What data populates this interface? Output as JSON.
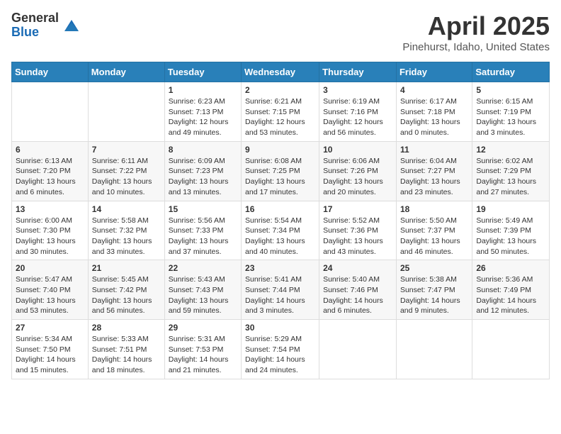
{
  "logo": {
    "general": "General",
    "blue": "Blue"
  },
  "title": "April 2025",
  "subtitle": "Pinehurst, Idaho, United States",
  "days_header": [
    "Sunday",
    "Monday",
    "Tuesday",
    "Wednesday",
    "Thursday",
    "Friday",
    "Saturday"
  ],
  "weeks": [
    [
      {
        "day": "",
        "sunrise": "",
        "sunset": "",
        "daylight": ""
      },
      {
        "day": "",
        "sunrise": "",
        "sunset": "",
        "daylight": ""
      },
      {
        "day": "1",
        "sunrise": "Sunrise: 6:23 AM",
        "sunset": "Sunset: 7:13 PM",
        "daylight": "Daylight: 12 hours and 49 minutes."
      },
      {
        "day": "2",
        "sunrise": "Sunrise: 6:21 AM",
        "sunset": "Sunset: 7:15 PM",
        "daylight": "Daylight: 12 hours and 53 minutes."
      },
      {
        "day": "3",
        "sunrise": "Sunrise: 6:19 AM",
        "sunset": "Sunset: 7:16 PM",
        "daylight": "Daylight: 12 hours and 56 minutes."
      },
      {
        "day": "4",
        "sunrise": "Sunrise: 6:17 AM",
        "sunset": "Sunset: 7:18 PM",
        "daylight": "Daylight: 13 hours and 0 minutes."
      },
      {
        "day": "5",
        "sunrise": "Sunrise: 6:15 AM",
        "sunset": "Sunset: 7:19 PM",
        "daylight": "Daylight: 13 hours and 3 minutes."
      }
    ],
    [
      {
        "day": "6",
        "sunrise": "Sunrise: 6:13 AM",
        "sunset": "Sunset: 7:20 PM",
        "daylight": "Daylight: 13 hours and 6 minutes."
      },
      {
        "day": "7",
        "sunrise": "Sunrise: 6:11 AM",
        "sunset": "Sunset: 7:22 PM",
        "daylight": "Daylight: 13 hours and 10 minutes."
      },
      {
        "day": "8",
        "sunrise": "Sunrise: 6:09 AM",
        "sunset": "Sunset: 7:23 PM",
        "daylight": "Daylight: 13 hours and 13 minutes."
      },
      {
        "day": "9",
        "sunrise": "Sunrise: 6:08 AM",
        "sunset": "Sunset: 7:25 PM",
        "daylight": "Daylight: 13 hours and 17 minutes."
      },
      {
        "day": "10",
        "sunrise": "Sunrise: 6:06 AM",
        "sunset": "Sunset: 7:26 PM",
        "daylight": "Daylight: 13 hours and 20 minutes."
      },
      {
        "day": "11",
        "sunrise": "Sunrise: 6:04 AM",
        "sunset": "Sunset: 7:27 PM",
        "daylight": "Daylight: 13 hours and 23 minutes."
      },
      {
        "day": "12",
        "sunrise": "Sunrise: 6:02 AM",
        "sunset": "Sunset: 7:29 PM",
        "daylight": "Daylight: 13 hours and 27 minutes."
      }
    ],
    [
      {
        "day": "13",
        "sunrise": "Sunrise: 6:00 AM",
        "sunset": "Sunset: 7:30 PM",
        "daylight": "Daylight: 13 hours and 30 minutes."
      },
      {
        "day": "14",
        "sunrise": "Sunrise: 5:58 AM",
        "sunset": "Sunset: 7:32 PM",
        "daylight": "Daylight: 13 hours and 33 minutes."
      },
      {
        "day": "15",
        "sunrise": "Sunrise: 5:56 AM",
        "sunset": "Sunset: 7:33 PM",
        "daylight": "Daylight: 13 hours and 37 minutes."
      },
      {
        "day": "16",
        "sunrise": "Sunrise: 5:54 AM",
        "sunset": "Sunset: 7:34 PM",
        "daylight": "Daylight: 13 hours and 40 minutes."
      },
      {
        "day": "17",
        "sunrise": "Sunrise: 5:52 AM",
        "sunset": "Sunset: 7:36 PM",
        "daylight": "Daylight: 13 hours and 43 minutes."
      },
      {
        "day": "18",
        "sunrise": "Sunrise: 5:50 AM",
        "sunset": "Sunset: 7:37 PM",
        "daylight": "Daylight: 13 hours and 46 minutes."
      },
      {
        "day": "19",
        "sunrise": "Sunrise: 5:49 AM",
        "sunset": "Sunset: 7:39 PM",
        "daylight": "Daylight: 13 hours and 50 minutes."
      }
    ],
    [
      {
        "day": "20",
        "sunrise": "Sunrise: 5:47 AM",
        "sunset": "Sunset: 7:40 PM",
        "daylight": "Daylight: 13 hours and 53 minutes."
      },
      {
        "day": "21",
        "sunrise": "Sunrise: 5:45 AM",
        "sunset": "Sunset: 7:42 PM",
        "daylight": "Daylight: 13 hours and 56 minutes."
      },
      {
        "day": "22",
        "sunrise": "Sunrise: 5:43 AM",
        "sunset": "Sunset: 7:43 PM",
        "daylight": "Daylight: 13 hours and 59 minutes."
      },
      {
        "day": "23",
        "sunrise": "Sunrise: 5:41 AM",
        "sunset": "Sunset: 7:44 PM",
        "daylight": "Daylight: 14 hours and 3 minutes."
      },
      {
        "day": "24",
        "sunrise": "Sunrise: 5:40 AM",
        "sunset": "Sunset: 7:46 PM",
        "daylight": "Daylight: 14 hours and 6 minutes."
      },
      {
        "day": "25",
        "sunrise": "Sunrise: 5:38 AM",
        "sunset": "Sunset: 7:47 PM",
        "daylight": "Daylight: 14 hours and 9 minutes."
      },
      {
        "day": "26",
        "sunrise": "Sunrise: 5:36 AM",
        "sunset": "Sunset: 7:49 PM",
        "daylight": "Daylight: 14 hours and 12 minutes."
      }
    ],
    [
      {
        "day": "27",
        "sunrise": "Sunrise: 5:34 AM",
        "sunset": "Sunset: 7:50 PM",
        "daylight": "Daylight: 14 hours and 15 minutes."
      },
      {
        "day": "28",
        "sunrise": "Sunrise: 5:33 AM",
        "sunset": "Sunset: 7:51 PM",
        "daylight": "Daylight: 14 hours and 18 minutes."
      },
      {
        "day": "29",
        "sunrise": "Sunrise: 5:31 AM",
        "sunset": "Sunset: 7:53 PM",
        "daylight": "Daylight: 14 hours and 21 minutes."
      },
      {
        "day": "30",
        "sunrise": "Sunrise: 5:29 AM",
        "sunset": "Sunset: 7:54 PM",
        "daylight": "Daylight: 14 hours and 24 minutes."
      },
      {
        "day": "",
        "sunrise": "",
        "sunset": "",
        "daylight": ""
      },
      {
        "day": "",
        "sunrise": "",
        "sunset": "",
        "daylight": ""
      },
      {
        "day": "",
        "sunrise": "",
        "sunset": "",
        "daylight": ""
      }
    ]
  ]
}
